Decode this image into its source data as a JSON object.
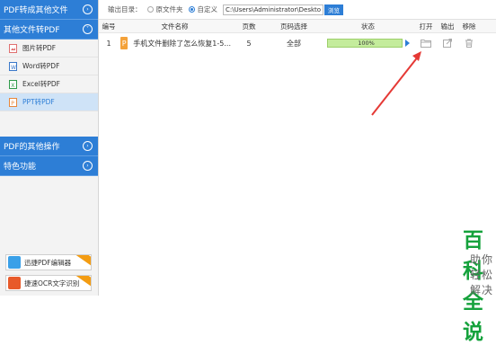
{
  "sidebar": {
    "sections": [
      {
        "label": "PDF转成其他文件",
        "expanded": false
      },
      {
        "label": "其他文件转PDF",
        "expanded": true
      },
      {
        "label": "PDF的其他操作",
        "expanded": false
      },
      {
        "label": "特色功能",
        "expanded": false
      }
    ],
    "items": [
      {
        "label": "图片转PDF",
        "icon": "image-file-icon"
      },
      {
        "label": "Word转PDF",
        "icon": "word-file-icon"
      },
      {
        "label": "Excel转PDF",
        "icon": "excel-file-icon"
      },
      {
        "label": "PPT转PDF",
        "icon": "ppt-file-icon",
        "active": true
      }
    ],
    "promos": [
      {
        "label": "迅捷PDF编辑器"
      },
      {
        "label": "捷速OCR文字识别"
      }
    ]
  },
  "toolbar": {
    "output_label": "输出目录：",
    "option_original": "原文件夹",
    "option_custom": "自定义",
    "path_value": "C:\\Users\\Administrator\\Desktop",
    "browse_label": "浏览"
  },
  "table": {
    "headers": [
      "编号",
      "文件名称",
      "页数",
      "页码选择",
      "状态",
      "打开",
      "输出",
      "移除"
    ],
    "rows": [
      {
        "index": "1",
        "filename": "手机文件删除了怎么恢复1-5...",
        "pages": "5",
        "page_range": "全部",
        "progress_text": "100%",
        "progress": 1.0
      }
    ]
  },
  "watermark": {
    "title": "百科全说",
    "subtitle": "助你轻松解决"
  },
  "colors": {
    "accent": "#2d7ed6",
    "progress_fill": "#c4ec9c",
    "annotation": "#e53935",
    "watermark": "#15a23c"
  }
}
